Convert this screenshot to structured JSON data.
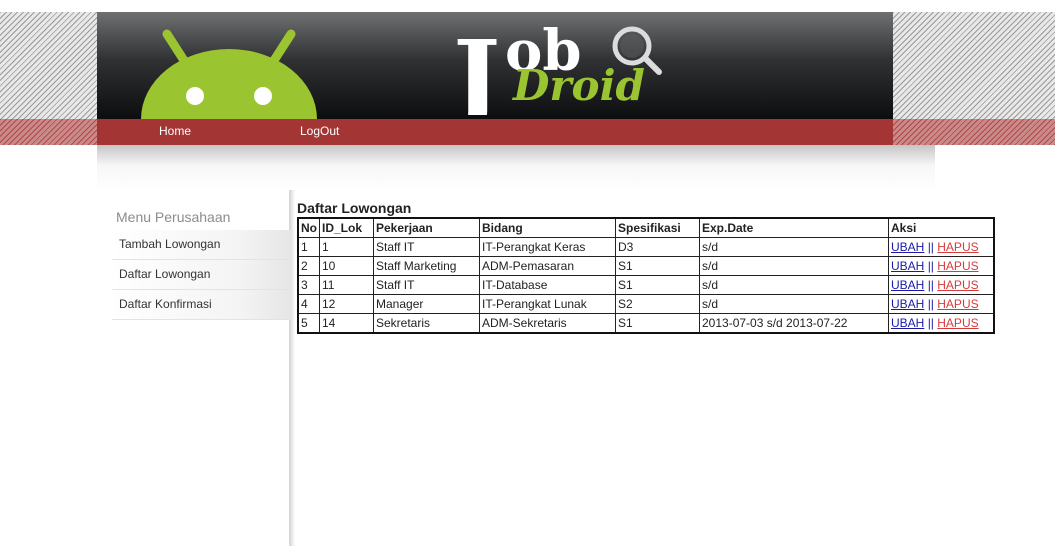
{
  "brand": {
    "logo_word_top": "ob",
    "logo_word_bottom": "Droid",
    "logo_letter": "J",
    "name": "JobDroid"
  },
  "nav": {
    "home": "Home",
    "logout": "LogOut"
  },
  "sidebar": {
    "title": "Menu Perusahaan",
    "items": [
      {
        "label": "Tambah Lowongan"
      },
      {
        "label": "Daftar Lowongan"
      },
      {
        "label": "Daftar Konfirmasi"
      }
    ]
  },
  "main": {
    "title": "Daftar Lowongan",
    "table": {
      "headers": [
        "No",
        "ID_Lok",
        "Pekerjaan",
        "Bidang",
        "Spesifikasi",
        "Exp.Date",
        "Aksi"
      ],
      "rows": [
        [
          "1",
          "1",
          "Staff IT",
          "IT-Perangkat Keras",
          "D3",
          "s/d"
        ],
        [
          "2",
          "10",
          "Staff Marketing",
          "ADM-Pemasaran",
          "S1",
          "s/d"
        ],
        [
          "3",
          "11",
          "Staff IT",
          "IT-Database",
          "S1",
          "s/d"
        ],
        [
          "4",
          "12",
          "Manager",
          "IT-Perangkat Lunak",
          "S2",
          "s/d"
        ],
        [
          "5",
          "14",
          "Sekretaris",
          "ADM-Sekretaris",
          "S1",
          "2013-07-03 s/d 2013-07-22"
        ]
      ],
      "action_edit": "UBAH",
      "action_sep": "||",
      "action_delete": "HAPUS"
    }
  },
  "colors": {
    "navbar": "#a43535",
    "android_green": "#9bc431",
    "banner_dark": "#0c0d0e",
    "delete_link": "#d63b3b",
    "edit_link": "#1a1aa6"
  }
}
